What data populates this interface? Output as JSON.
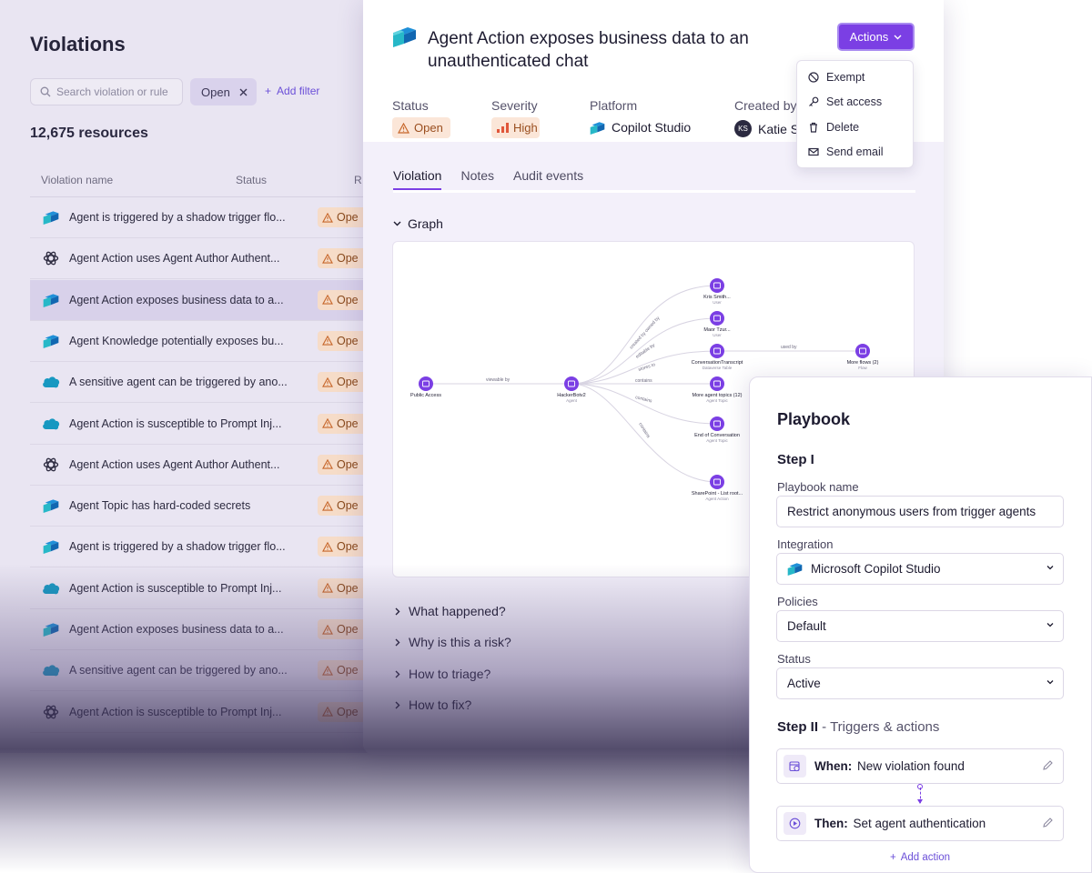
{
  "violations": {
    "title": "Violations",
    "search_placeholder": "Search violation or rule",
    "filter_chip": "Open",
    "add_filter": "Add filter",
    "count": "12,675 resources",
    "columns": [
      "Violation name",
      "Status",
      "R"
    ],
    "rows": [
      {
        "icon": "copilot-studio-icon",
        "name": "Agent is triggered by a shadow trigger flo...",
        "status": "Ope"
      },
      {
        "icon": "openai-icon",
        "name": "Agent Action uses Agent Author Authent...",
        "status": "Ope"
      },
      {
        "icon": "copilot-studio-icon",
        "name": "Agent Action exposes business data to a...",
        "status": "Ope",
        "selected": true
      },
      {
        "icon": "copilot-studio-icon",
        "name": "Agent Knowledge potentially exposes bu...",
        "status": "Ope"
      },
      {
        "icon": "salesforce-icon",
        "name": "A sensitive agent can be triggered by ano...",
        "status": "Ope"
      },
      {
        "icon": "salesforce-icon",
        "name": "Agent Action is susceptible to Prompt Inj...",
        "status": "Ope"
      },
      {
        "icon": "openai-icon",
        "name": "Agent Action uses Agent Author Authent...",
        "status": "Ope"
      },
      {
        "icon": "copilot-studio-icon",
        "name": "Agent Topic has hard-coded secrets",
        "status": "Ope"
      },
      {
        "icon": "copilot-studio-icon",
        "name": "Agent is triggered by a shadow trigger flo...",
        "status": "Ope"
      },
      {
        "icon": "salesforce-icon",
        "name": "Agent Action is susceptible to Prompt Inj...",
        "status": "Ope"
      },
      {
        "icon": "copilot-studio-icon",
        "name": "Agent Action exposes business data to a...",
        "status": "Ope"
      },
      {
        "icon": "salesforce-icon",
        "name": "A sensitive agent can be triggered by ano...",
        "status": "Ope"
      },
      {
        "icon": "openai-icon",
        "name": "Agent Action is susceptible to Prompt Inj...",
        "status": "Ope"
      }
    ]
  },
  "detail": {
    "title": "Agent Action exposes business data to an unauthenticated chat",
    "actions_label": "Actions",
    "meta": {
      "status_label": "Status",
      "status_value": "Open",
      "severity_label": "Severity",
      "severity_value": "High",
      "platform_label": "Platform",
      "platform_value": "Copilot Studio",
      "created_label": "Created by",
      "created_value": "Katie S",
      "created_initials": "KS"
    },
    "tabs": [
      "Violation",
      "Notes",
      "Audit events"
    ],
    "graph_title": "Graph",
    "graph": {
      "nodes": [
        {
          "name": "Public Access",
          "type": ""
        },
        {
          "name": "HackerBotv2",
          "type": "Agent"
        },
        {
          "name": "Kris Smith...",
          "type": "User"
        },
        {
          "name": "Maor Tzur...",
          "type": "User"
        },
        {
          "name": "ConversationTranscript",
          "type": "Dataverse Table"
        },
        {
          "name": "More agent topics (12)",
          "type": "Agent Topic"
        },
        {
          "name": "End of Conversation",
          "type": "Agent Topic"
        },
        {
          "name": "SharePoint - List root...",
          "type": "Agent Action"
        },
        {
          "name": "More flows (2)",
          "type": "Flow"
        }
      ],
      "edges": [
        "viewable by",
        "created by owned by",
        "editable by",
        "stores to",
        "contains",
        "contains",
        "contains",
        "used by"
      ]
    },
    "accordions": [
      "What happened?",
      "Why is this a risk?",
      "How to triage?",
      "How to fix?"
    ]
  },
  "menu": {
    "items": [
      {
        "icon": "ban-icon",
        "label": "Exempt"
      },
      {
        "icon": "key-icon",
        "label": "Set access"
      },
      {
        "icon": "trash-icon",
        "label": "Delete"
      },
      {
        "icon": "mail-icon",
        "label": "Send email"
      }
    ]
  },
  "playbook": {
    "title": "Playbook",
    "step1": "Step I",
    "name_label": "Playbook name",
    "name_value": "Restrict anonymous users from trigger agents",
    "integration_label": "Integration",
    "integration_value": "Microsoft Copilot Studio",
    "policies_label": "Policies",
    "policies_value": "Default",
    "status_label": "Status",
    "status_value": "Active",
    "step2": "Step II",
    "step2_sub": " - Triggers & actions",
    "when_label": "When:",
    "when_value": "New violation found",
    "then_label": "Then:",
    "then_value": "Set agent authentication",
    "add_action": "Add action"
  },
  "colors": {
    "accent": "#7b3fe4",
    "warning_bg": "#fbe6d8",
    "warning_text": "#9a4e1f"
  }
}
